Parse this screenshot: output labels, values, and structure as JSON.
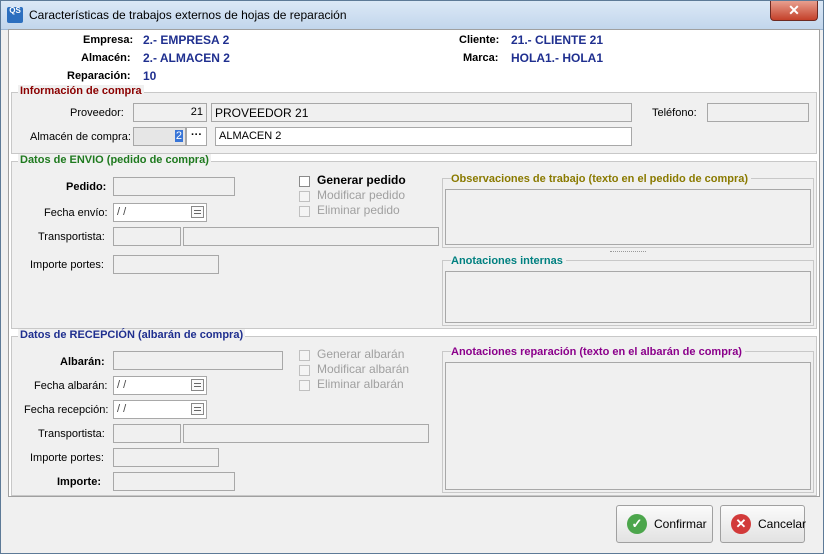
{
  "window": {
    "title": "Características de trabajos externos de hojas de reparación",
    "app_icon": "QS"
  },
  "header": {
    "empresa_label": "Empresa:",
    "empresa_value": "2.- EMPRESA 2",
    "almacen_label": "Almacén:",
    "almacen_value": "2.- ALMACEN 2",
    "reparacion_label": "Reparación:",
    "reparacion_value": "10",
    "cliente_label": "Cliente:",
    "cliente_value": "21.- CLIENTE 21",
    "marca_label": "Marca:",
    "marca_value": "HOLA1.- HOLA1"
  },
  "compra": {
    "legend": "Información de compra",
    "proveedor_label": "Proveedor:",
    "proveedor_code": "21",
    "proveedor_name": "PROVEEDOR 21",
    "telefono_label": "Teléfono:",
    "telefono_value": "",
    "almacen_compra_label": "Almacén de compra:",
    "almacen_compra_code": "2",
    "almacen_compra_btn": "···",
    "almacen_compra_name": "ALMACEN 2"
  },
  "envio": {
    "legend": "Datos de ENVIO (pedido de compra)",
    "pedido_label": "Pedido:",
    "fecha_envio_label": "Fecha envío:",
    "fecha_envio_value": " /  /",
    "transportista_label": "Transportista:",
    "importe_portes_label": "Importe portes:",
    "generar_label": "Generar pedido",
    "modificar_label": "Modificar pedido",
    "eliminar_label": "Eliminar pedido",
    "obs_title": "Observaciones de trabajo (texto en el pedido de compra)",
    "anot_title": "Anotaciones internas"
  },
  "recepcion": {
    "legend": "Datos de RECEPCIÓN (albarán de compra)",
    "albaran_label": "Albarán:",
    "fecha_albaran_label": "Fecha albarán:",
    "fecha_albaran_value": " /  /",
    "fecha_recepcion_label": "Fecha recepción:",
    "fecha_recepcion_value": " /  /",
    "transportista_label": "Transportista:",
    "importe_portes_label": "Importe portes:",
    "importe_label": "Importe:",
    "generar_label": "Generar albarán",
    "modificar_label": "Modificar albarán",
    "eliminar_label": "Eliminar albarán",
    "anot_rep_title": "Anotaciones reparación (texto en el albarán de compra)"
  },
  "buttons": {
    "confirmar": "Confirmar",
    "cancelar": "Cancelar"
  },
  "colors": {
    "compra_legend": "#8b0000",
    "envio_legend": "#1f7a1f",
    "recepcion_legend": "#1f2f8f",
    "obs": "#8a7a00",
    "anot": "#008080",
    "anot_rep": "#8b008b"
  }
}
